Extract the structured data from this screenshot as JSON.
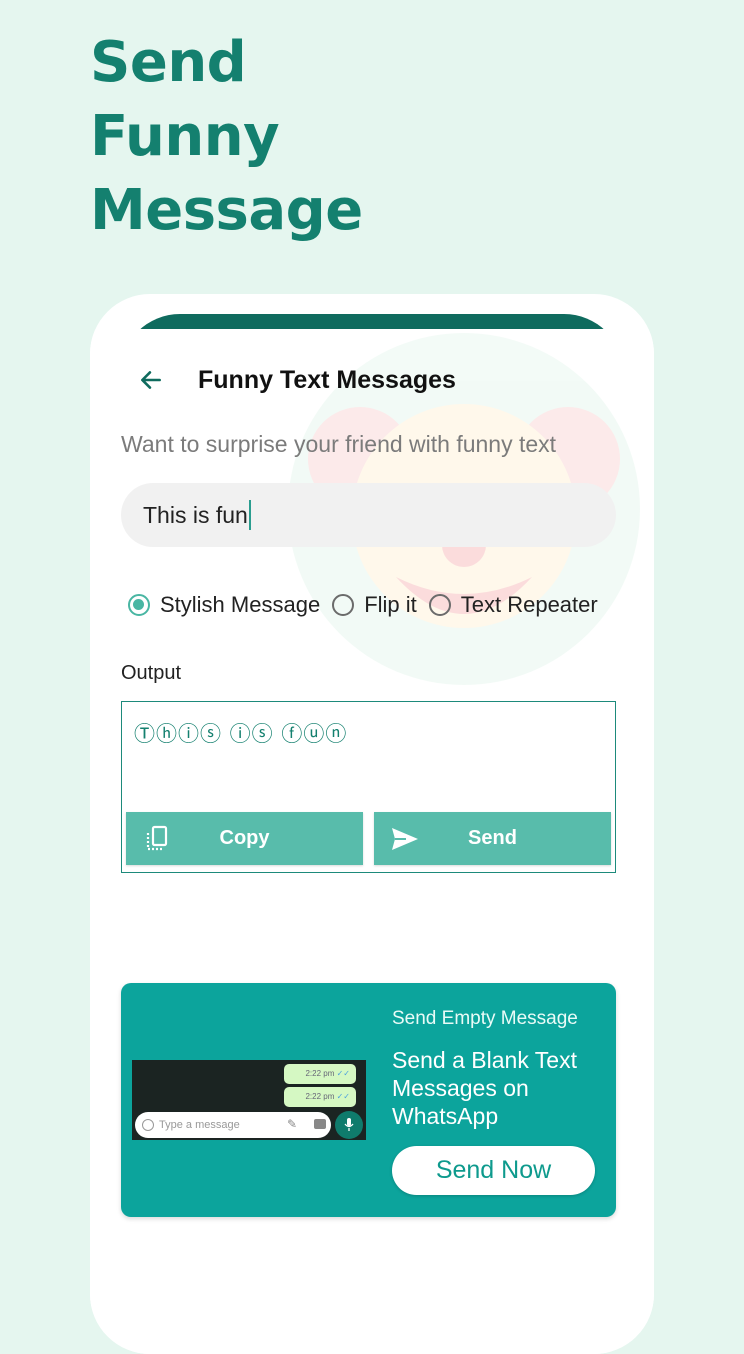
{
  "headline": [
    "Send",
    "Funny",
    "Message"
  ],
  "appbar": {
    "title": "Funny Text Messages",
    "back_icon": "arrow-left-icon"
  },
  "prompt": "Want to surprise your friend with funny text",
  "input": {
    "value": "This is fun"
  },
  "modes": [
    {
      "label": "Stylish Message",
      "checked": true
    },
    {
      "label": "Flip it",
      "checked": false
    },
    {
      "label": "Text Repeater",
      "checked": false
    }
  ],
  "output": {
    "label": "Output",
    "text": "Ⓣⓗⓘⓢ ⓘⓢ ⓕⓤⓝ",
    "copy_label": "Copy",
    "send_label": "Send"
  },
  "promo": {
    "kicker": "Send Empty Message",
    "title": "Send a Blank Text Messages on WhatsApp",
    "cta": "Send Now",
    "preview": {
      "bubble_times": [
        "2:22 pm",
        "2:22 pm"
      ],
      "input_placeholder": "Type a message"
    }
  },
  "colors": {
    "background": "#e5f6ef",
    "headline": "#14806f",
    "accent": "#58bcab",
    "promo": "#0ca49c"
  }
}
